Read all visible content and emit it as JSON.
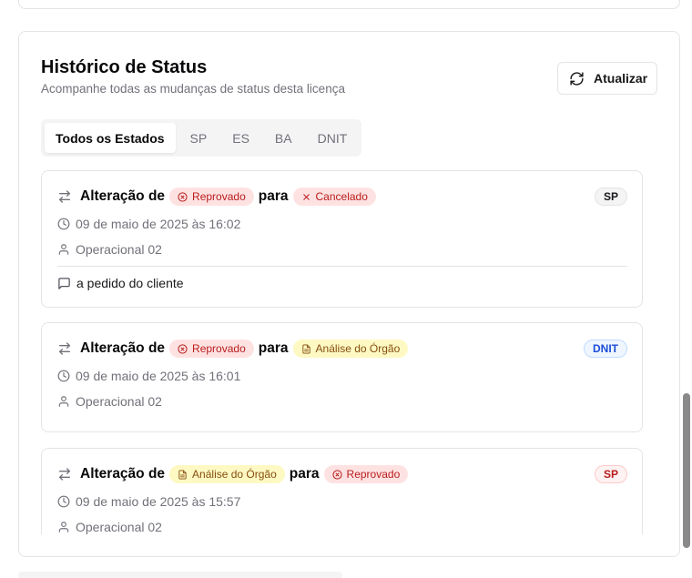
{
  "history": {
    "title": "Histórico de Status",
    "subtitle": "Acompanhe todas as mudanças de status desta licença",
    "refresh_label": "Atualizar",
    "tabs": [
      {
        "label": "Todos os Estados",
        "active": true
      },
      {
        "label": "SP",
        "active": false
      },
      {
        "label": "ES",
        "active": false
      },
      {
        "label": "BA",
        "active": false
      },
      {
        "label": "DNIT",
        "active": false
      }
    ],
    "entries": [
      {
        "change_label": "Alteração de",
        "connector": "para",
        "from_status": "Reprovado",
        "to_status": "Cancelado",
        "state": "SP",
        "date": "09 de maio de 2025 às 16:02",
        "user": "Operacional 02",
        "comment": "a pedido do cliente"
      },
      {
        "change_label": "Alteração de",
        "connector": "para",
        "from_status": "Reprovado",
        "to_status": "Análise do Órgão",
        "state": "DNIT",
        "date": "09 de maio de 2025 às 16:01",
        "user": "Operacional 02"
      },
      {
        "change_label": "Alteração de",
        "connector": "para",
        "from_status": "Análise do Órgão",
        "to_status": "Reprovado",
        "state": "SP",
        "date": "09 de maio de 2025 às 15:57",
        "user": "Operacional 02"
      }
    ]
  },
  "colors": {
    "status_red_bg": "#fee2e2",
    "status_red_text": "#b91c1c",
    "status_yellow_bg": "#fef9c3",
    "status_yellow_text": "#854d0e",
    "badge_blue": "#1d4ed8"
  },
  "icons": {
    "refresh": "refresh-icon",
    "swap": "arrows-swap-icon",
    "clock": "clock-icon",
    "user": "user-icon",
    "comment": "message-square-icon",
    "x_circle": "x-circle-icon",
    "x": "x-icon",
    "document": "file-text-icon"
  }
}
